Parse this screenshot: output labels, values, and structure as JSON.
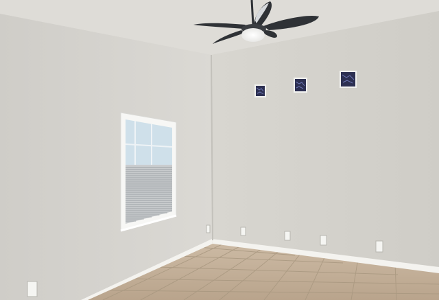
{
  "scene": {
    "description_tags": [
      "empty-room",
      "ceiling-fan",
      "window-with-blinds",
      "decorative-glass-blocks",
      "tile-floor",
      "baseboards",
      "electrical-outlets"
    ],
    "colors": {
      "ceiling": "#dedcd7",
      "left_wall": "#d6d4cf",
      "right_wall": "#d3d1cb",
      "floor": "#c4b29c",
      "grout": "#a99880",
      "baseboard": "#f4f3ef",
      "window_frame": "#f7f7f5",
      "blind_slats": "#c9ccce",
      "sky": "#cfe0ea",
      "fan_blade": "#2f3236",
      "fan_light": "#f4f4f2",
      "glass_block": "#2d3052"
    },
    "watermark": ""
  }
}
